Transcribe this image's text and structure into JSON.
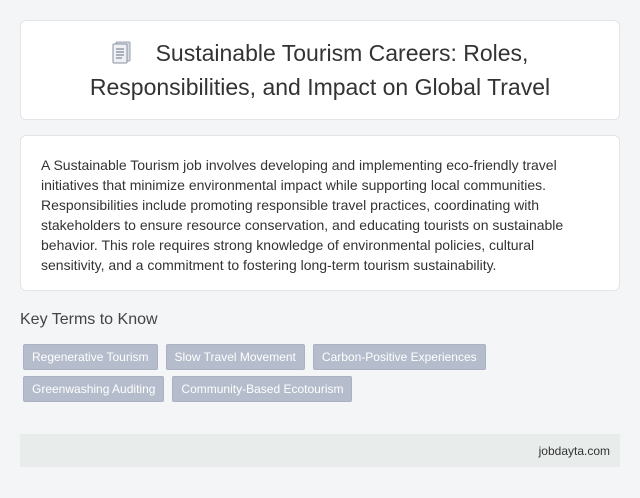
{
  "header": {
    "icon": "document-icon",
    "title": "Sustainable Tourism Careers: Roles, Responsibilities, and Impact on Global Travel"
  },
  "description": "A Sustainable Tourism job involves developing and implementing eco-friendly travel initiatives that minimize environmental impact while supporting local communities. Responsibilities include promoting responsible travel practices, coordinating with stakeholders to ensure resource conservation, and educating tourists on sustainable behavior. This role requires strong knowledge of environmental policies, cultural sensitivity, and a commitment to fostering long-term tourism sustainability.",
  "key_terms": {
    "heading": "Key Terms to Know",
    "tags": [
      "Regenerative Tourism",
      "Slow Travel Movement",
      "Carbon-Positive Experiences",
      "Greenwashing Auditing",
      "Community-Based Ecotourism"
    ]
  },
  "footer": {
    "site": "jobdayta.com"
  },
  "colors": {
    "background": "#f4f5f7",
    "card": "#ffffff",
    "tag_background": "#b5bccc",
    "tag_text": "#ffffff",
    "footer_background": "#e8edec"
  }
}
